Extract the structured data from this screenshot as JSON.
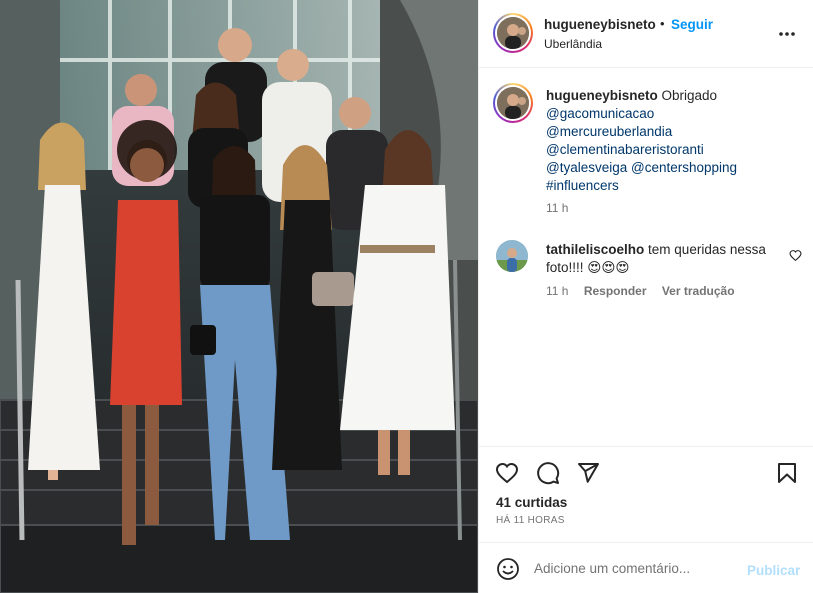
{
  "post": {
    "username": "hugueneybisneto",
    "separator": "•",
    "follow_label": "Seguir",
    "location": "Uberlândia",
    "more_icon": "more-horizontal-icon"
  },
  "caption": {
    "username": "hugueneybisneto",
    "text": "Obrigado",
    "mentions": [
      "@gacomunicacao",
      "@mercureuberlandia",
      "@clementinabareristoranti",
      "@tyalesveiga",
      "@centershopping",
      "#influencers"
    ],
    "time": "11 h"
  },
  "comment": {
    "username": "tathileliscoelho",
    "text": "tem queridas nessa foto!!!! 😍😍😍",
    "time": "11 h",
    "reply_label": "Responder",
    "translate_label": "Ver tradução"
  },
  "actions": {
    "like_icon": "heart-icon",
    "comment_icon": "comment-icon",
    "share_icon": "share-icon",
    "save_icon": "bookmark-icon",
    "likes": "41 curtidas",
    "ago": "HÁ 11 HORAS"
  },
  "add_comment": {
    "placeholder": "Adicione um comentário...",
    "publish_label": "Publicar",
    "emoji_icon": "emoji-icon"
  },
  "colors": {
    "accent": "#0095f6",
    "link": "#00376b",
    "muted": "#737373",
    "publish_disabled": "#b2dffc"
  }
}
